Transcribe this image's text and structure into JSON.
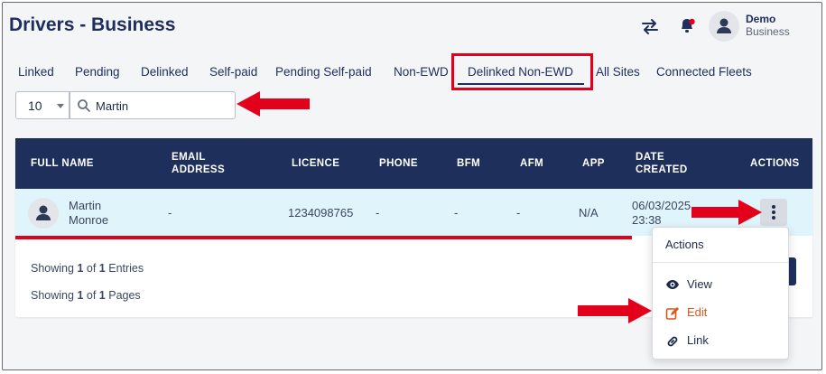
{
  "header": {
    "title": "Drivers - Business",
    "user": {
      "name": "Demo",
      "role": "Business"
    }
  },
  "tabs": [
    {
      "label": "Linked"
    },
    {
      "label": "Pending"
    },
    {
      "label": "Delinked"
    },
    {
      "label": "Self-paid"
    },
    {
      "label": "Pending Self-paid"
    },
    {
      "label": "Non-EWD"
    },
    {
      "label": "Delinked Non-EWD",
      "active": true
    },
    {
      "label": "All Sites"
    },
    {
      "label": "Connected Fleets"
    }
  ],
  "controls": {
    "page_size": "10",
    "search_value": "Martin"
  },
  "table": {
    "columns": [
      "FULL NAME",
      "EMAIL ADDRESS",
      "LICENCE",
      "PHONE",
      "BFM",
      "AFM",
      "APP",
      "DATE CREATED",
      "ACTIONS"
    ],
    "rows": [
      {
        "name_first": "Martin",
        "name_last": "Monroe",
        "email": "-",
        "licence": "1234098765",
        "phone": "-",
        "bfm": "-",
        "afm": "-",
        "app": "N/A",
        "date": "06/03/2025",
        "time": "23:38"
      }
    ]
  },
  "summary": {
    "entries": {
      "prefix": "Showing",
      "current": "1",
      "of": "of",
      "total": "1",
      "suffix": "Entries"
    },
    "pages": {
      "prefix": "Showing",
      "current": "1",
      "of": "of",
      "total": "1",
      "suffix": "Pages"
    }
  },
  "actions_menu": {
    "title": "Actions",
    "items": [
      {
        "label": "View",
        "icon": "eye-icon",
        "color": "#1e2a4a"
      },
      {
        "label": "Edit",
        "icon": "edit-icon",
        "color": "#e0531a"
      },
      {
        "label": "Link",
        "icon": "link-icon",
        "color": "#1e2a4a"
      }
    ]
  },
  "colors": {
    "navy": "#1f2f5c",
    "highlight_red": "#e3001b",
    "row_bg": "#dff4fb",
    "edit_orange": "#e0531a"
  }
}
